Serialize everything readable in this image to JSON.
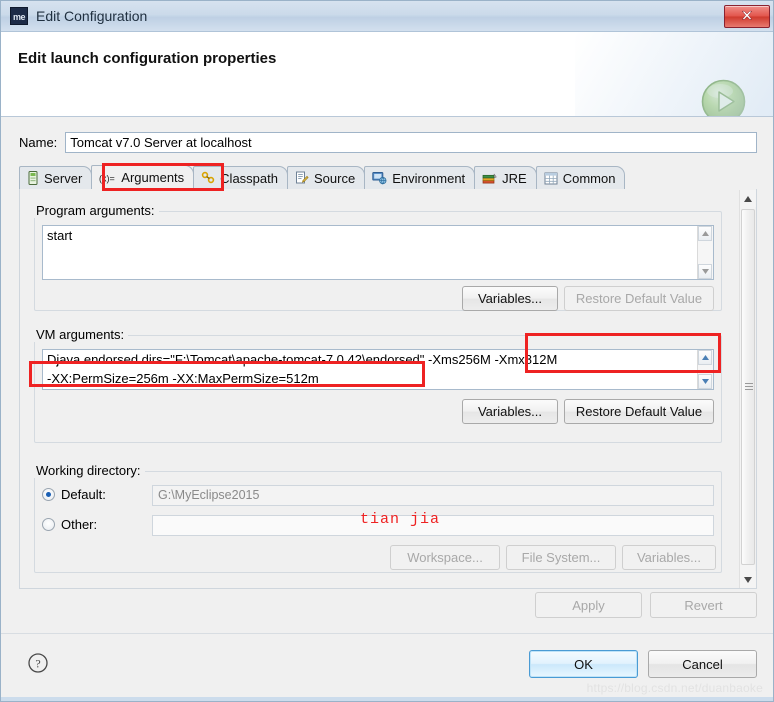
{
  "window": {
    "title": "Edit Configuration",
    "app_icon": "me",
    "close_icon": "close-icon"
  },
  "header": {
    "title": "Edit launch configuration properties",
    "run_icon": "run-play-icon"
  },
  "name_field": {
    "label": "Name:",
    "value": "Tomcat v7.0 Server at localhost"
  },
  "tabs": [
    {
      "label": "Server",
      "icon": "server-icon",
      "active": false
    },
    {
      "label": "Arguments",
      "icon": "variables-icon",
      "active": true
    },
    {
      "label": "Classpath",
      "icon": "classpath-icon",
      "active": false
    },
    {
      "label": "Source",
      "icon": "source-icon",
      "active": false
    },
    {
      "label": "Environment",
      "icon": "environment-icon",
      "active": false
    },
    {
      "label": "JRE",
      "icon": "jre-icon",
      "active": false
    },
    {
      "label": "Common",
      "icon": "common-icon",
      "active": false
    }
  ],
  "program_arguments": {
    "group_label": "Program arguments:",
    "value": "start",
    "variables_button": "Variables...",
    "restore_button": "Restore Default Value",
    "restore_enabled": false
  },
  "vm_arguments": {
    "group_label": "VM arguments:",
    "line1": "Djava.endorsed.dirs=\"F:\\Tomcat\\apache-tomcat-7.0.42\\endorsed\" -Xms256M -Xmx812M",
    "line2": "-XX:PermSize=256m -XX:MaxPermSize=512m",
    "variables_button": "Variables...",
    "restore_button": "Restore Default Value",
    "restore_enabled": true
  },
  "working_directory": {
    "group_label": "Working directory:",
    "default_label": "Default:",
    "default_value": "G:\\MyEclipse2015",
    "default_selected": true,
    "other_label": "Other:",
    "other_value": "",
    "other_selected": false,
    "workspace_button": "Workspace...",
    "filesystem_button": "File System...",
    "variables_button": "Variables..."
  },
  "action_buttons": {
    "apply": "Apply",
    "revert": "Revert",
    "apply_enabled": false,
    "revert_enabled": false
  },
  "footer": {
    "help_icon": "help-question-icon",
    "ok": "OK",
    "cancel": "Cancel",
    "watermark": "https://blog.csdn.net/duanbaoke"
  },
  "annotations": {
    "color": "#ee2222",
    "note_text": "tian jia"
  }
}
